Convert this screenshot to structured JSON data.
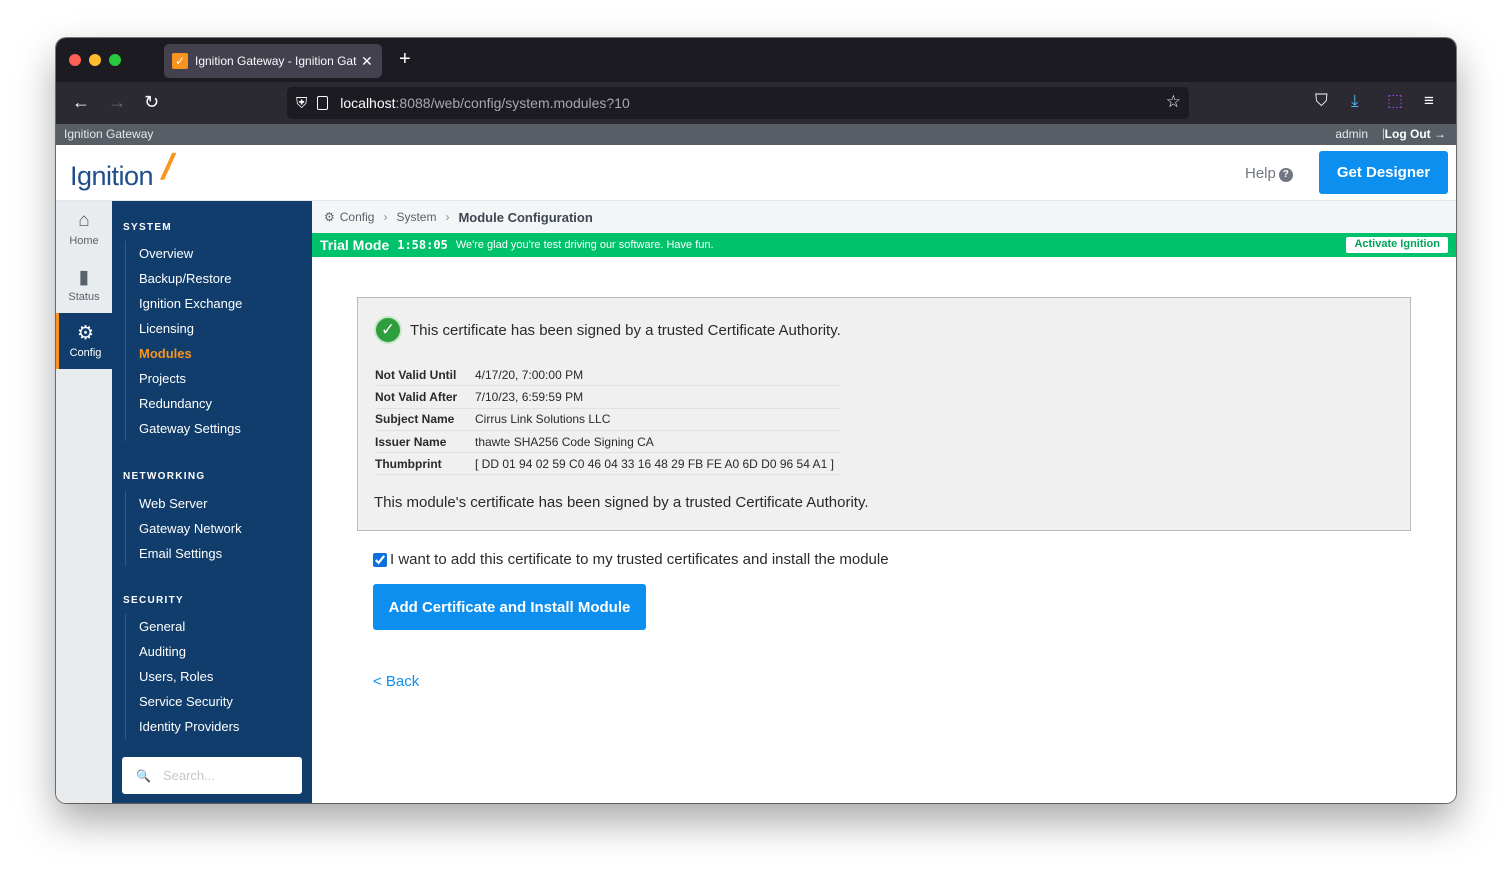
{
  "browser": {
    "tab_title": "Ignition Gateway - Ignition Gateway",
    "favicon_glyph": "✓",
    "tab_close": "✕",
    "new_tab": "+",
    "url_host": "localhost",
    "url_rest": ":8088/web/config/system.modules?10",
    "back_glyph": "←",
    "forward_glyph": "→",
    "reload_glyph": "↻",
    "star_glyph": "☆",
    "pocket_glyph": "⛉",
    "download_glyph": "⤓",
    "extension_glyph": "⬚",
    "menu_glyph": "≡",
    "shield_glyph": "⛨"
  },
  "gateway_bar": {
    "title": "Ignition Gateway",
    "user": "admin",
    "separator": "|",
    "logout": "Log Out →"
  },
  "header": {
    "logo_text": "Ignition",
    "logo_mark": "/",
    "help": "Help",
    "help_icon": "?",
    "get_designer": "Get Designer"
  },
  "rail": [
    {
      "label": "Home",
      "glyph": "⌂"
    },
    {
      "label": "Status",
      "glyph": "▮"
    },
    {
      "label": "Config",
      "glyph": "⚙"
    }
  ],
  "sidebar": {
    "system_title": "SYSTEM",
    "system_items": [
      "Overview",
      "Backup/Restore",
      "Ignition Exchange",
      "Licensing",
      "Modules",
      "Projects",
      "Redundancy",
      "Gateway Settings"
    ],
    "networking_title": "NETWORKING",
    "networking_items": [
      "Web Server",
      "Gateway Network",
      "Email Settings"
    ],
    "security_title": "SECURITY",
    "security_items": [
      "General",
      "Auditing",
      "Users, Roles",
      "Service Security",
      "Identity Providers"
    ],
    "search_placeholder": "Search...",
    "search_glyph": "🔍"
  },
  "breadcrumb": {
    "config_glyph": "⚙",
    "config": "Config",
    "sep": "›",
    "system": "System",
    "current": "Module Configuration"
  },
  "trial": {
    "label": "Trial Mode",
    "timer": "1:58:05",
    "message": "We're glad you're test driving our software. Have fun.",
    "activate": "Activate Ignition"
  },
  "certificate": {
    "check_glyph": "✓",
    "heading": "This certificate has been signed by a trusted Certificate Authority.",
    "rows": [
      {
        "key": "Not Valid Until",
        "value": "4/17/20, 7:00:00 PM"
      },
      {
        "key": "Not Valid After",
        "value": "7/10/23, 6:59:59 PM"
      },
      {
        "key": "Subject Name",
        "value": "Cirrus Link Solutions LLC"
      },
      {
        "key": "Issuer Name",
        "value": "thawte SHA256 Code Signing CA"
      },
      {
        "key": "Thumbprint",
        "value": "[ DD 01 94 02 59 C0 46 04 33 16 48 29 FB FE A0 6D D0 96 54 A1 ]"
      }
    ],
    "footer": "This module's certificate has been signed by a trusted Certificate Authority."
  },
  "agreement": {
    "checked": true,
    "label": "I want to add this certificate to my trusted certificates and install the module"
  },
  "install_button": "Add Certificate and Install Module",
  "back_link": "<  Back"
}
